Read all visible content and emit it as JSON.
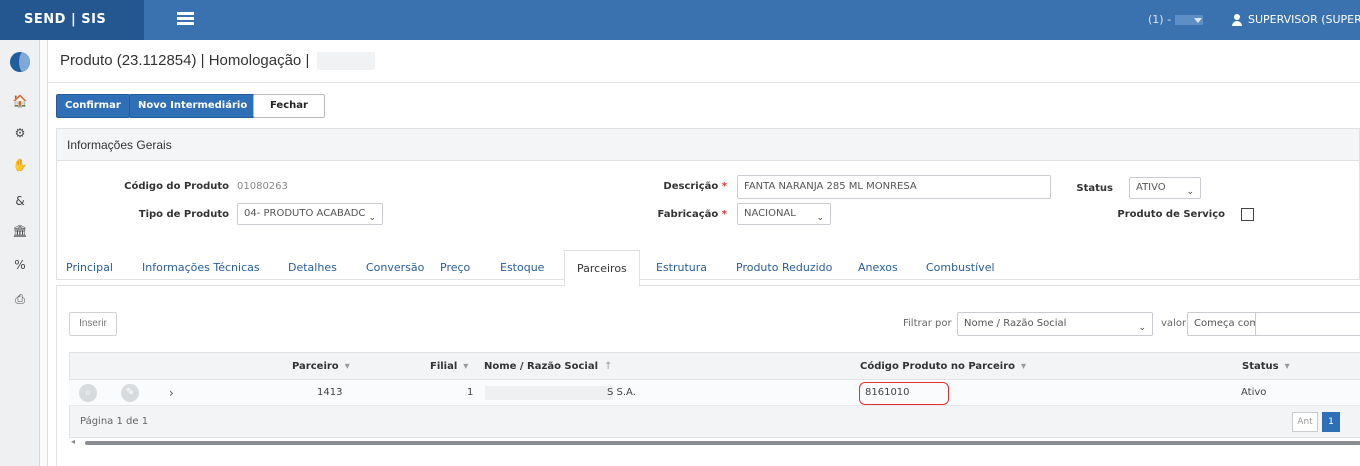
{
  "topbar": {
    "brand": "SEND | SIS",
    "selector_prefix": "(1) -",
    "user": "SUPERVISOR (SUPERV"
  },
  "sidebar": {
    "icons": [
      "home-icon",
      "cogs-icon",
      "handshake-icon",
      "ampersand-icon",
      "bank-icon",
      "percent-icon",
      "print-icon"
    ],
    "glyphs": [
      "🏠",
      "⚙",
      "✋",
      "&",
      "🏛",
      "%",
      "⎙"
    ]
  },
  "page": {
    "title": "Produto (23.112854) | Homologação |"
  },
  "toolbar": {
    "confirm": "Confirmar",
    "new_intermediate": "Novo Intermediário",
    "close": "Fechar"
  },
  "general_info": {
    "heading": "Informações Gerais",
    "product_code_label": "Código do Produto",
    "product_code": "01080263",
    "product_type_label": "Tipo de Produto",
    "product_type": "04- PRODUTO ACABADC",
    "description_label": "Descrição",
    "description": "FANTA NARANJA 285 ML MONRESA",
    "manufacture_label": "Fabricação",
    "manufacture": "NACIONAL",
    "status_label": "Status",
    "status": "ATIVO",
    "service_label": "Produto de Serviço",
    "required_mark": "*"
  },
  "tabs": [
    "Principal",
    "Informações Técnicas",
    "Detalhes",
    "Conversão",
    "Preço",
    "Estoque",
    "Parceiros",
    "Estrutura",
    "Produto Reduzido",
    "Anexos",
    "Combustível"
  ],
  "partners": {
    "insert": "Inserir",
    "filter_by": "Filtrar por",
    "filter_field": "Nome / Razão Social",
    "value_label": "valor",
    "filter_mode": "Começa com",
    "columns": {
      "partner": "Parceiro",
      "branch": "Filial",
      "name": "Nome / Razão Social",
      "partner_code": "Código Produto no Parceiro",
      "status": "Status"
    },
    "sort_down": "▾",
    "sort_up": "↑",
    "row": {
      "partner": "1413",
      "branch": "1",
      "name": "S S.A.",
      "partner_code": "8161010",
      "status": "Ativo"
    },
    "pager": "Página 1 de 1",
    "prev": "Ant",
    "page": "1"
  }
}
